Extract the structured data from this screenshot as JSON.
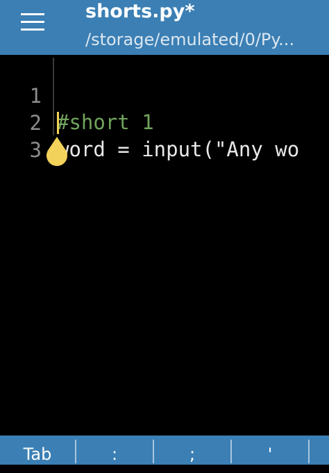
{
  "header": {
    "title": "shorts.py*",
    "subtitle": "/storage/emulated/0/Py..."
  },
  "editor": {
    "lines": [
      {
        "number": "1",
        "text": "#short 1",
        "kind": "comment"
      },
      {
        "number": "2",
        "text": "word = input(\"Any wo",
        "kind": "code"
      },
      {
        "number": "3",
        "text": "",
        "kind": "code"
      }
    ],
    "cursor_line": 3
  },
  "keybar": {
    "keys": [
      "Tab",
      ":",
      ";",
      "'",
      ""
    ]
  },
  "colors": {
    "accent": "#3b7fb4",
    "comment": "#71a45c",
    "cursor": "#f2d25a",
    "editor_bg": "#000000"
  },
  "icons": {
    "menu": "hamburger-menu-icon",
    "cursor_handle": "text-cursor-handle-icon"
  }
}
